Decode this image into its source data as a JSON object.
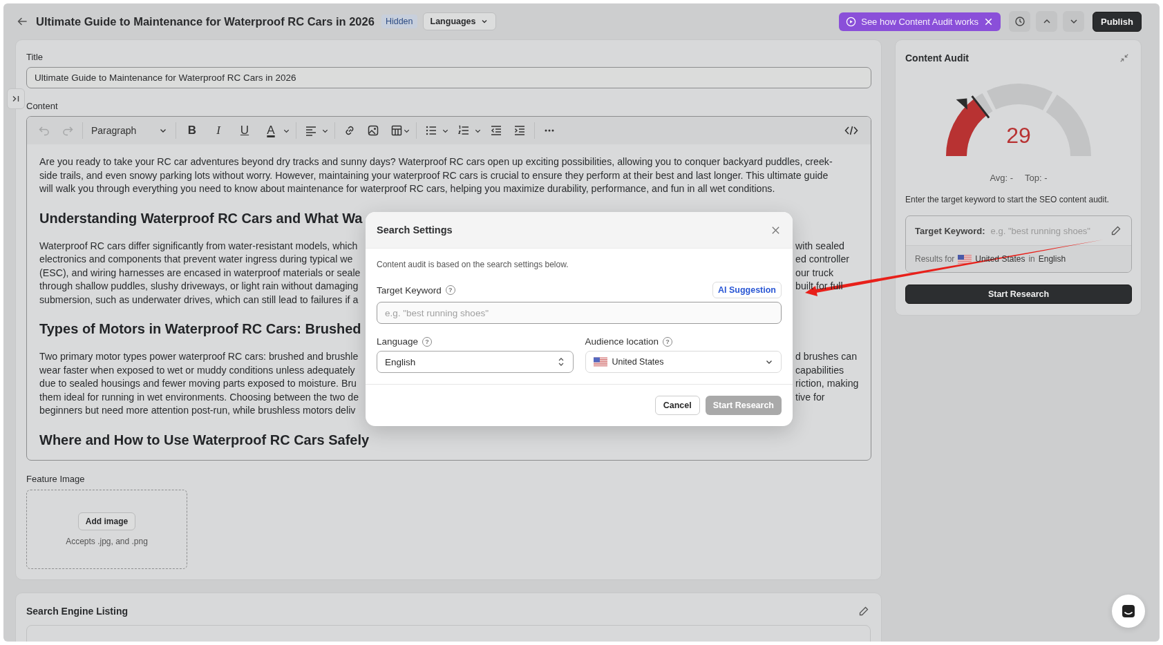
{
  "header": {
    "title": "Ultimate Guide to Maintenance for Waterproof RC Cars in 2026",
    "status": "Hidden",
    "languages": "Languages",
    "promo": "See how Content Audit works",
    "publish": "Publish"
  },
  "title_field": {
    "label": "Title",
    "value": "Ultimate Guide to Maintenance for Waterproof RC Cars in 2026"
  },
  "content_label": "Content",
  "toolbar": {
    "undo_disabled": true,
    "redo_disabled": true,
    "block_format": "Paragraph",
    "format_buttons": [
      {
        "kind": "bold",
        "glyph": "B"
      },
      {
        "kind": "italic",
        "glyph": "I"
      },
      {
        "kind": "underline",
        "glyph": "U"
      },
      {
        "kind": "color",
        "glyph": "A"
      }
    ]
  },
  "content": [
    {
      "kind": "paragraph",
      "lines": [
        {
          "left": "Are you ready to take your RC car adventures beyond dry tracks and sunny days? Waterproof RC cars open up exciting possibilities, allowing you to conquer backyard puddles, creek-"
        },
        {
          "left": "side trails, and even snowy parking lots without worry. However, maintaining your waterproof RC cars is crucial to ensure they perform at their best and last longer. This ultimate guide"
        },
        {
          "left": "will walk you through everything you need to know about maintenance for waterproof RC cars, helping you maximize durability, performance, and fun in all wet conditions."
        }
      ]
    },
    {
      "kind": "heading",
      "text": "Understanding Waterproof RC Cars and What Wa"
    },
    {
      "kind": "paragraph",
      "lines": [
        {
          "left": "Waterproof RC cars differ significantly from water-resistant models, which",
          "right": "with sealed"
        },
        {
          "left": "electronics and components that prevent water ingress during typical we",
          "right": "ed controller"
        },
        {
          "left": "(ESC), and wiring harnesses are encased in waterproof materials or seale",
          "right": "our truck"
        },
        {
          "left": "through shallow puddles, slushy driveways, or light rain without damaging",
          "right": "built for full"
        },
        {
          "left": "submersion, such as underwater drives, which can still lead to failures if a"
        }
      ]
    },
    {
      "kind": "heading",
      "text": "Types of Motors in Waterproof RC Cars: Brushed"
    },
    {
      "kind": "paragraph",
      "lines": [
        {
          "left": "Two primary motor types power waterproof RC cars: brushed and brushle",
          "right": "d brushes can"
        },
        {
          "left": "wear faster when exposed to wet or muddy conditions unless adequately",
          "right": "capabilities"
        },
        {
          "left": "due to sealed housings and fewer moving parts exposed to moisture. Bru",
          "right": "riction, making"
        },
        {
          "left": "them ideal for running in wet environments. Choosing between the two de",
          "right": "tive for"
        },
        {
          "left": "beginners but need more attention post-run, while brushless motors deliv"
        }
      ]
    },
    {
      "kind": "heading",
      "text": "Where and How to Use Waterproof RC Cars Safely"
    }
  ],
  "feature_image": {
    "label": "Feature Image",
    "button": "Add image",
    "hint": "Accepts .jpg, and .png"
  },
  "search_listing": {
    "title": "Search Engine Listing"
  },
  "audit": {
    "title": "Content Audit",
    "score": "29",
    "level": 0.29,
    "avg": "Avg: -",
    "top": "Top: -",
    "hint": "Enter the target keyword to start the SEO content audit.",
    "keyword_label": "Target Keyword:",
    "keyword_placeholder": "e.g. \"best running shoes\"",
    "results_prefix": "Results for",
    "country": "United States",
    "in": "in",
    "language": "English",
    "button": "Start Research"
  },
  "modal": {
    "title": "Search Settings",
    "description": "Content audit is based on the search settings below.",
    "keyword_label": "Target Keyword",
    "keyword_help": "?",
    "ai_suggestion": "AI Suggestion",
    "keyword_placeholder": "e.g. \"best running shoes\"",
    "language_label": "Language",
    "language_help": "?",
    "language": "English",
    "location_label": "Audience location",
    "location_help": "?",
    "location": "United States",
    "cancel": "Cancel",
    "start": "Start Research",
    "start_disabled": true
  }
}
